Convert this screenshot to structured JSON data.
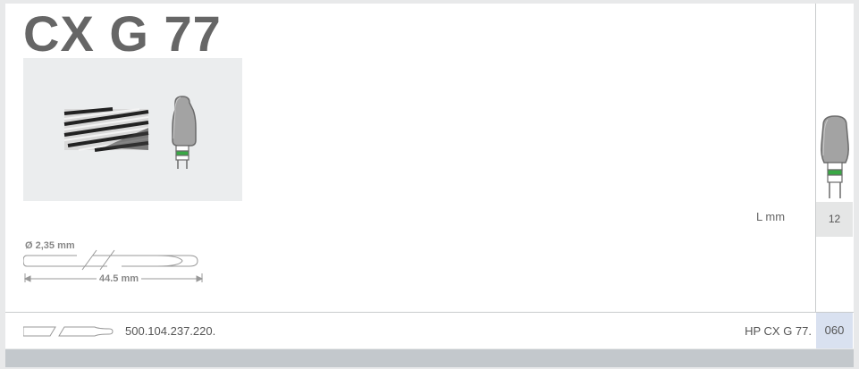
{
  "product": {
    "title": "CX G 77"
  },
  "dimensions": {
    "diameter_label": "Ø 2,35 mm",
    "length_label": "44.5 mm"
  },
  "specs": {
    "length_header": "L mm",
    "length_value": "12"
  },
  "article": {
    "part_number": "500.104.237.220.",
    "hp_code": "HP CX G 77.",
    "size": "060"
  },
  "colors": {
    "band_green": "#39a845",
    "bur_grey": "#a3a3a3",
    "size_cell_bg": "#d9e1f0"
  },
  "icons": {
    "bur_thumbnail": "bur-head-icon",
    "shank_outline": "shank-outline-icon"
  }
}
